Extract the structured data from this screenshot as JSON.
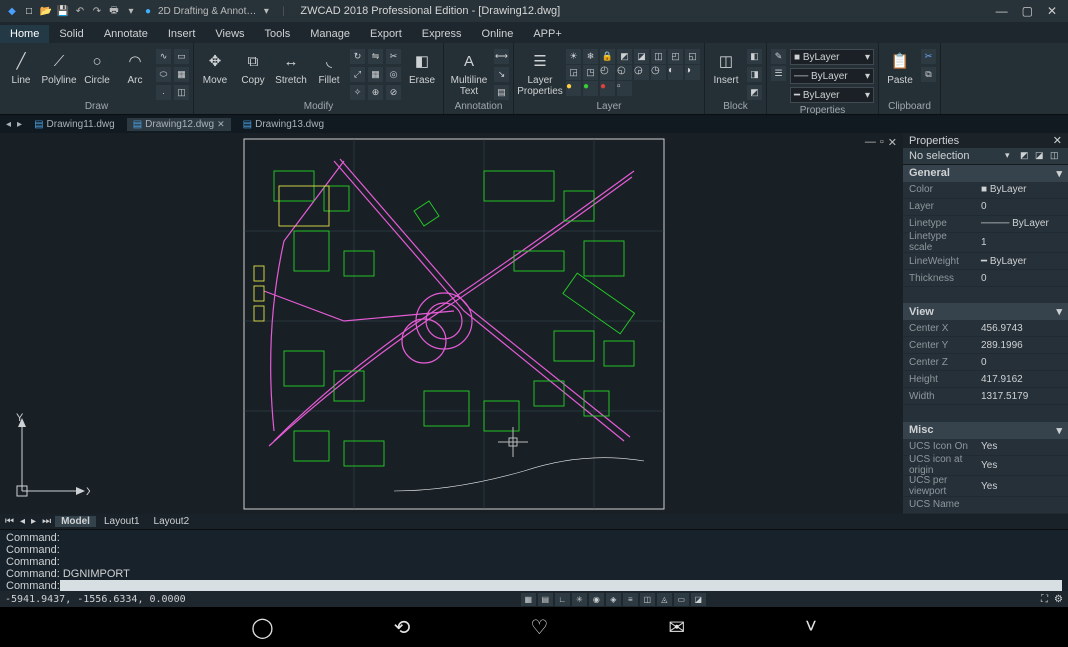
{
  "title": "ZWCAD 2018 Professional Edition - [Drawing12.dwg]",
  "workspace_selector": "2D Drafting & Annot…",
  "menubar": [
    "Home",
    "Solid",
    "Annotate",
    "Insert",
    "Views",
    "Tools",
    "Manage",
    "Export",
    "Express",
    "Online",
    "APP+"
  ],
  "ribbon": {
    "draw": {
      "label": "Draw",
      "line": "Line",
      "polyline": "Polyline",
      "circle": "Circle",
      "arc": "Arc"
    },
    "modify": {
      "label": "Modify",
      "move": "Move",
      "copy": "Copy",
      "stretch": "Stretch",
      "fillet": "Fillet",
      "erase": "Erase"
    },
    "annotation": {
      "label": "Annotation",
      "mtext": "Multiline\nText"
    },
    "layer": {
      "label": "Layer",
      "props": "Layer\nProperties"
    },
    "block": {
      "label": "Block",
      "insert": "Insert"
    },
    "properties": {
      "label": "Properties",
      "bylayer": "ByLayer"
    },
    "clipboard": {
      "label": "Clipboard",
      "paste": "Paste"
    }
  },
  "file_tabs": [
    {
      "name": "Drawing11.dwg",
      "active": false
    },
    {
      "name": "Drawing12.dwg",
      "active": true
    },
    {
      "name": "Drawing13.dwg",
      "active": false
    }
  ],
  "layout_tabs": {
    "model": "Model",
    "l1": "Layout1",
    "l2": "Layout2"
  },
  "command_history": [
    "Command:",
    "Command:",
    "Command:",
    "Command: DGNIMPORT"
  ],
  "command_prompt": "Command: ",
  "status_coords": "-5941.9437, -1556.6334, 0.0000",
  "props": {
    "title": "Properties",
    "selection": "No selection",
    "sections": {
      "general": {
        "title": "General",
        "rows": [
          [
            "Color",
            "ByLayer"
          ],
          [
            "Layer",
            "0"
          ],
          [
            "Linetype",
            "ByLayer"
          ],
          [
            "Linetype scale",
            "1"
          ],
          [
            "LineWeight",
            "ByLayer"
          ],
          [
            "Thickness",
            "0"
          ]
        ]
      },
      "view": {
        "title": "View",
        "rows": [
          [
            "Center X",
            "456.9743"
          ],
          [
            "Center Y",
            "289.1996"
          ],
          [
            "Center Z",
            "0"
          ],
          [
            "Height",
            "417.9162"
          ],
          [
            "Width",
            "1317.5179"
          ]
        ]
      },
      "misc": {
        "title": "Misc",
        "rows": [
          [
            "UCS Icon On",
            "Yes"
          ],
          [
            "UCS icon at origin",
            "Yes"
          ],
          [
            "UCS per viewport",
            "Yes"
          ],
          [
            "UCS Name",
            ""
          ]
        ]
      }
    }
  },
  "ucs": {
    "x": "X",
    "y": "Y"
  }
}
